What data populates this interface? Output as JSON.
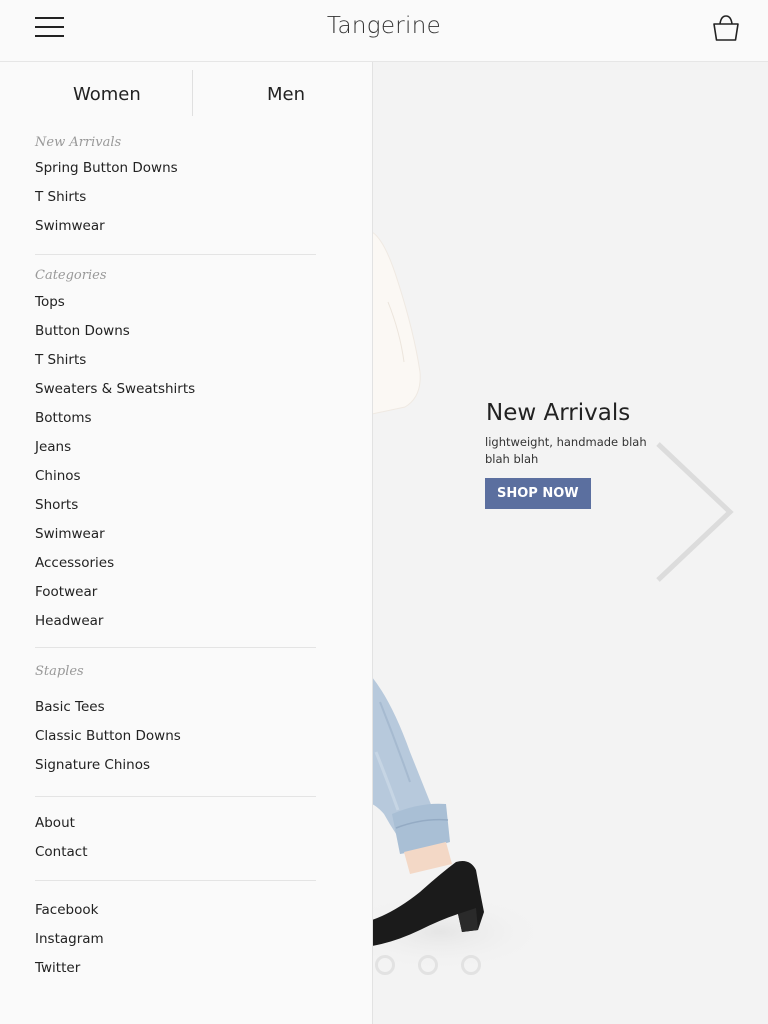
{
  "header": {
    "title": "Tangerine",
    "menu_icon": "hamburger-menu-icon",
    "cart_icon": "shopping-basket-icon"
  },
  "drawer": {
    "tabs": [
      {
        "label": "Women"
      },
      {
        "label": "Men"
      }
    ],
    "new_arrivals": {
      "heading": "New Arrivals",
      "items": [
        "Spring Button Downs",
        "T Shirts",
        "Swimwear"
      ]
    },
    "categories": {
      "heading": "Categories",
      "items": [
        "Tops",
        "Button Downs",
        "T Shirts",
        "Sweaters & Sweatshirts",
        "Bottoms",
        "Jeans",
        "Chinos",
        "Shorts",
        "Swimwear",
        "Accessories",
        "Footwear",
        "Headwear"
      ]
    },
    "staples": {
      "heading": "Staples",
      "items": [
        "Basic Tees",
        "Classic Button Downs",
        "Signature Chinos"
      ]
    },
    "info": {
      "items": [
        "About",
        "Contact"
      ]
    },
    "social": {
      "items": [
        "Facebook",
        "Instagram",
        "Twitter"
      ]
    }
  },
  "hero": {
    "title": "New Arrivals",
    "subtitle": "lightweight, handmade blah blah blah",
    "cta_label": "SHOP NOW",
    "cta_color": "#5b6f9f",
    "next_icon": "chevron-right-icon",
    "slide_count": 3
  }
}
